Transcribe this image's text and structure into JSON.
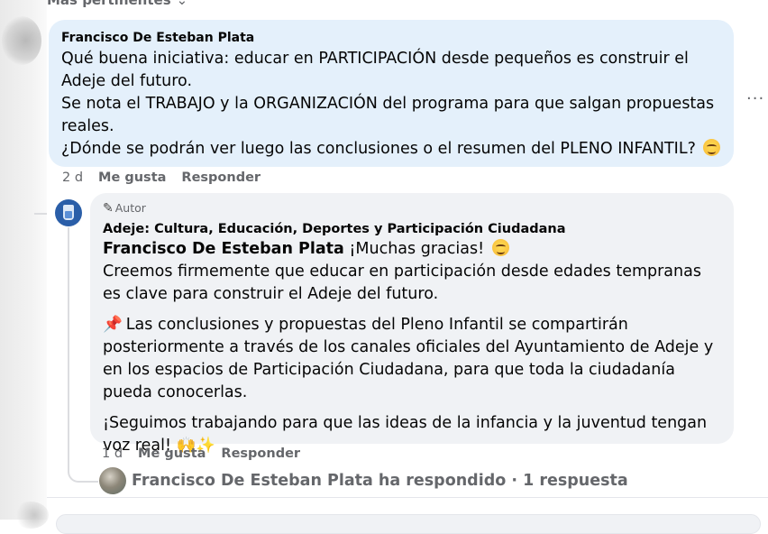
{
  "section": {
    "heading": "Más pertinentes"
  },
  "comment1": {
    "author": "Francisco De Esteban Plata",
    "lines": [
      "Qué buena iniciativa: educar en PARTICIPACIÓN desde pequeños es construir el Adeje del futuro.",
      "Se nota el TRABAJO y la ORGANIZACIÓN del programa para que salgan propuestas reales.",
      "¿Dónde se podrán ver luego las conclusiones o el resumen del PLENO INFANTIL?"
    ],
    "time": "2 d",
    "like_label": "Me gusta",
    "reply_label": "Responder",
    "more_label": "..."
  },
  "reply1": {
    "badge": "Autor",
    "page_name": "Adeje: Cultura, Educación, Deportes y Participación Ciudadana",
    "mention": "Francisco De Esteban Plata",
    "greeting": "¡Muchas gracias!",
    "p1": "Creemos firmemente que educar en participación desde edades tempranas es clave para construir el Adeje del futuro.",
    "pin_icon": "📌",
    "p2": "Las conclusiones y propuestas del Pleno Infantil se compartirán posteriormente a través de los canales oficiales del Ayuntamiento de Adeje y en los espacios de Participación Ciudadana, para que toda la ciudadanía pueda conocerlas.",
    "p3": "¡Seguimos trabajando para que las ideas de la infancia y la juventud tengan voz real!",
    "end_icons": "🙌✨",
    "time": "1 d",
    "like_label": "Me gusta",
    "reply_label": "Responder"
  },
  "replies_summary": {
    "text": "Francisco De Esteban Plata ha respondido · 1 respuesta"
  },
  "colors": {
    "comment_bubble": "#e4f0fb",
    "reply_bubble": "#f0f2f5",
    "meta_text": "#65676b",
    "page_avatar": "#2a5ea8"
  }
}
